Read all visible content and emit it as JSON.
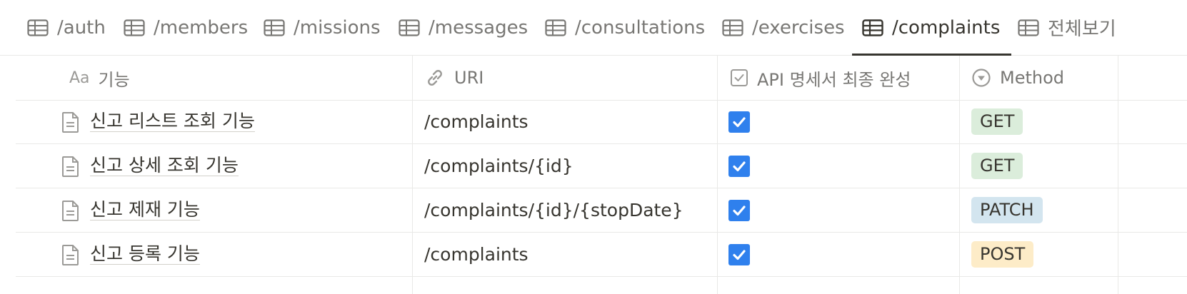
{
  "tabs": [
    {
      "label": "/auth",
      "active": false
    },
    {
      "label": "/members",
      "active": false
    },
    {
      "label": "/missions",
      "active": false
    },
    {
      "label": "/messages",
      "active": false
    },
    {
      "label": "/consultations",
      "active": false
    },
    {
      "label": "/exercises",
      "active": false
    },
    {
      "label": "/complaints",
      "active": true
    },
    {
      "label": "전체보기",
      "active": false
    }
  ],
  "columns": {
    "title": {
      "prefix": "Aa",
      "label": "기능",
      "icon": "text-property-icon"
    },
    "uri": {
      "label": "URI",
      "icon": "link-icon"
    },
    "spec_done": {
      "label": "API 명세서 최종 완성",
      "icon": "checkbox-property-icon"
    },
    "method": {
      "label": "Method",
      "icon": "select-property-icon"
    }
  },
  "rows": [
    {
      "title": "신고 리스트 조회 기능",
      "uri": "/complaints",
      "checked": true,
      "method": "GET"
    },
    {
      "title": "신고 상세 조회 기능",
      "uri": "/complaints/{id}",
      "checked": true,
      "method": "GET"
    },
    {
      "title": "신고 제재 기능",
      "uri": "/complaints/{id}/{stopDate}",
      "checked": true,
      "method": "PATCH"
    },
    {
      "title": "신고 등록 기능",
      "uri": "/complaints",
      "checked": true,
      "method": "POST"
    }
  ],
  "colors": {
    "checkbox": "#2f80ed",
    "get_pill": "#dbeddb",
    "patch_pill": "#d3e5ef",
    "post_pill": "#fdecc8",
    "active_tab_underline": "#37352f"
  }
}
